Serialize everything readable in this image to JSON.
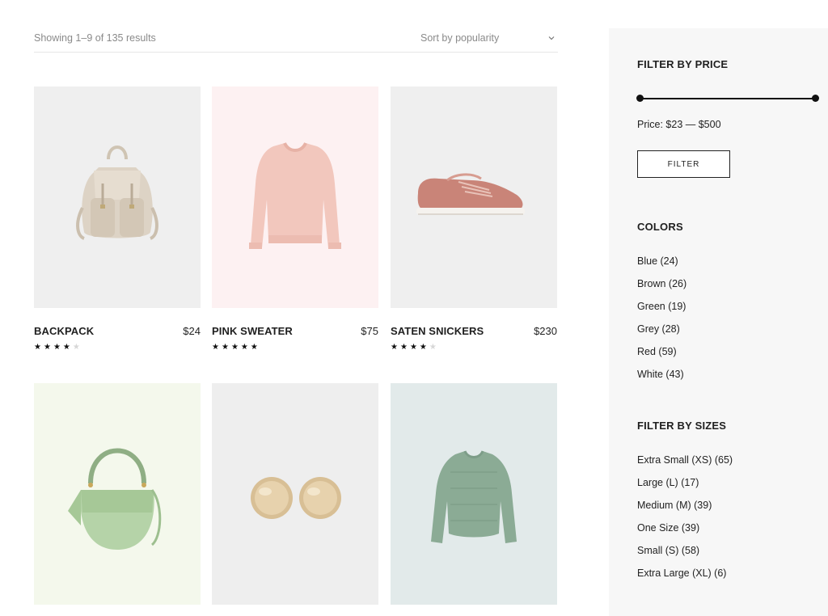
{
  "toolbar": {
    "result_count": "Showing 1–9 of 135 results",
    "sort_label": "Sort by popularity",
    "sort_icon": "chevron-down-icon"
  },
  "products": [
    {
      "name": "BACKPACK",
      "price": "$24",
      "rating": 4,
      "rating_max": 5,
      "bg_color": "#efefef",
      "image": "beige-backpack"
    },
    {
      "name": "PINK SWEATER",
      "price": "$75",
      "rating": 5,
      "rating_max": 5,
      "bg_color": "#fdf1f2",
      "image": "pink-sweatshirt"
    },
    {
      "name": "SATEN SNICKERS",
      "price": "$230",
      "rating": 4,
      "rating_max": 5,
      "bg_color": "#efefef",
      "image": "pink-satin-sneaker"
    },
    {
      "name": "",
      "price": "",
      "rating": 0,
      "rating_max": 5,
      "bg_color": "#f4f8ec",
      "image": "green-handbag"
    },
    {
      "name": "",
      "price": "",
      "rating": 0,
      "rating_max": 5,
      "bg_color": "#eeeeee",
      "image": "gold-earrings"
    },
    {
      "name": "",
      "price": "",
      "rating": 0,
      "rating_max": 5,
      "bg_color": "#e2eaea",
      "image": "green-sweater"
    }
  ],
  "sidebar": {
    "price": {
      "title": "FILTER BY PRICE",
      "range_text": "Price: $23 — $500",
      "min": 23,
      "max": 500,
      "button_label": "FILTER"
    },
    "colors": {
      "title": "COLORS",
      "items": [
        "Blue (24)",
        "Brown (26)",
        "Green (19)",
        "Grey (28)",
        "Red (59)",
        "White (43)"
      ]
    },
    "sizes": {
      "title": "FILTER BY SIZES",
      "items": [
        "Extra Small (XS) (65)",
        "Large (L) (17)",
        "Medium (M) (39)",
        "One Size (39)",
        "Small (S) (58)",
        "Extra Large (XL) (6)"
      ]
    }
  },
  "colors": {
    "sidebar_bg": "#f7f7f7",
    "text": "#222222",
    "muted": "#8a8a8a",
    "star_on": "#111111",
    "star_off": "#d7d7d7"
  }
}
